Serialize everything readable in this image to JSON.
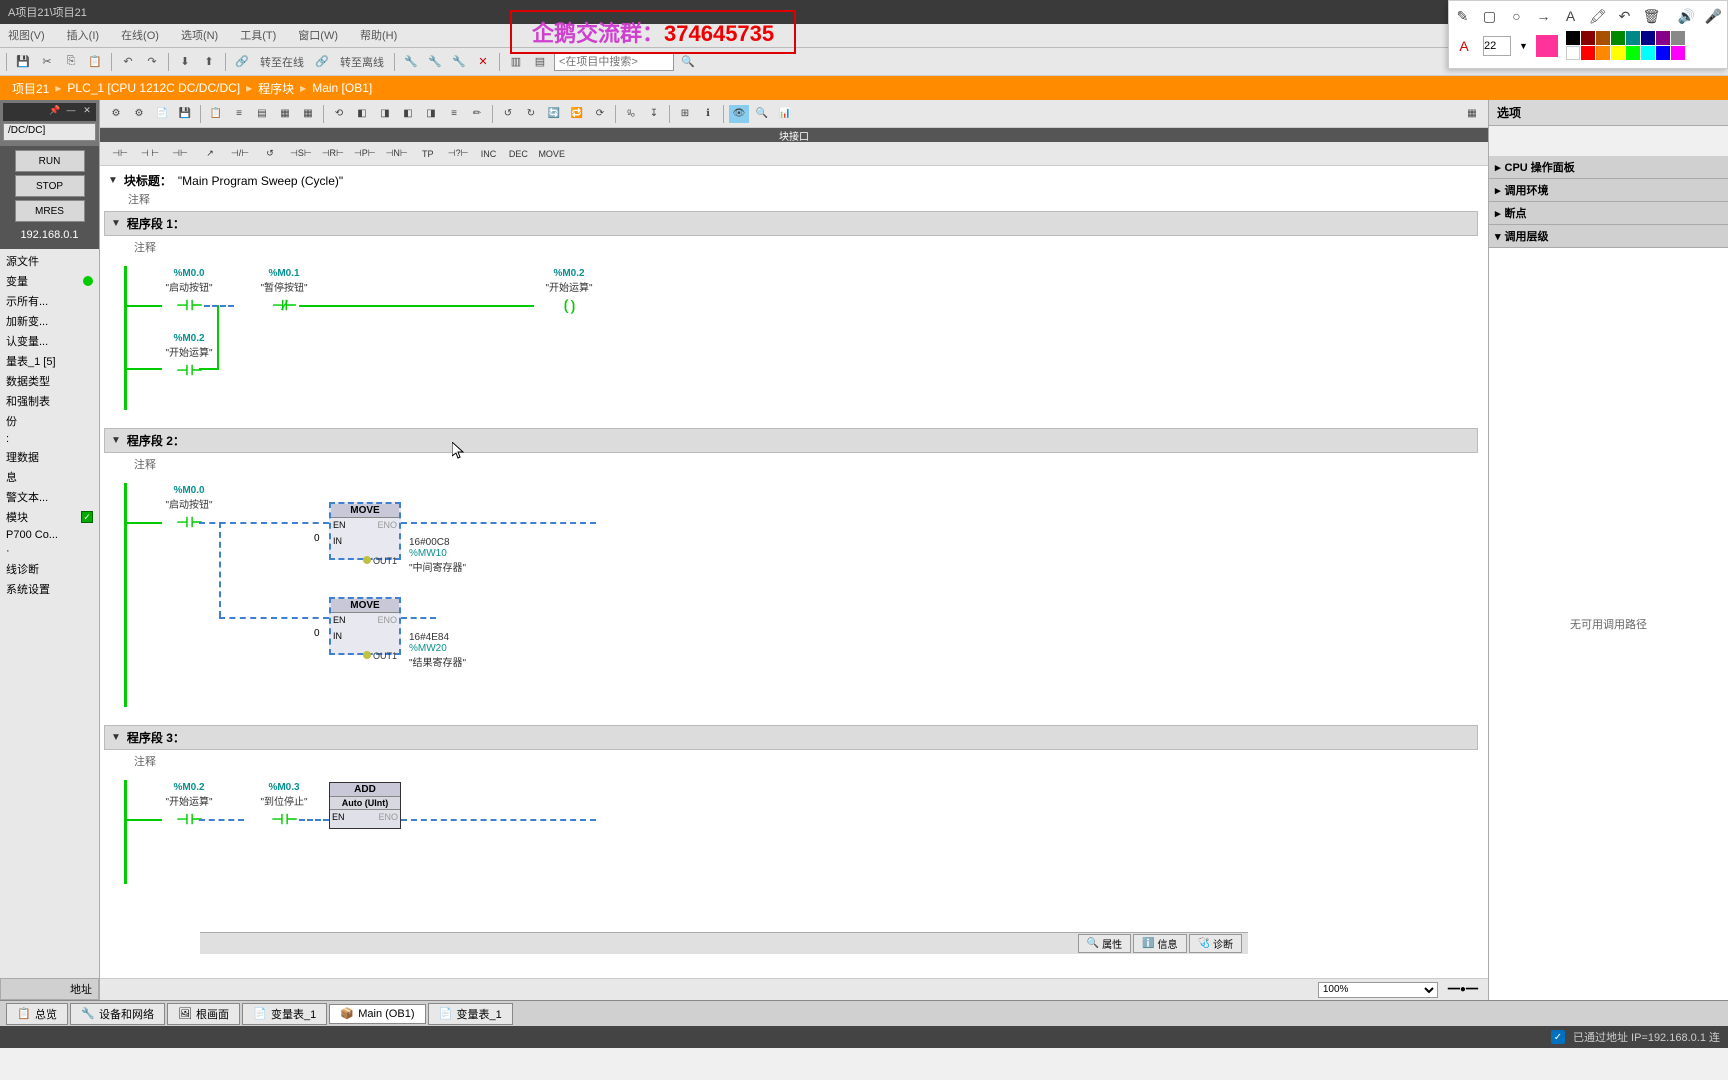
{
  "title_bar": "A项目21\\项目21",
  "overlay": {
    "label": "企鹅交流群：",
    "number": "374645735"
  },
  "menu": [
    "视图(V)",
    "插入(I)",
    "在线(O)",
    "选项(N)",
    "工具(T)",
    "窗口(W)",
    "帮助(H)"
  ],
  "toolbar": {
    "goto_online": "转至在线",
    "goto_offline": "转至离线",
    "search_placeholder": "<在项目中搜索>"
  },
  "breadcrumb": [
    "项目21",
    "PLC_1 [CPU 1212C DC/DC/DC]",
    "程序块",
    "Main [OB1]"
  ],
  "annotation": {
    "font_size": "22"
  },
  "cpu_panel": {
    "device": "/DC/DC]",
    "run": "RUN",
    "stop": "STOP",
    "mres": "MRES",
    "ip": "192.168.0.1"
  },
  "tree": [
    {
      "t": "源文件"
    },
    {
      "t": "变量",
      "dot": true
    },
    {
      "t": "示所有..."
    },
    {
      "t": "加新变..."
    },
    {
      "t": "认变量..."
    },
    {
      "t": "量表_1 [5]"
    },
    {
      "t": "数据类型"
    },
    {
      "t": "和强制表"
    },
    {
      "t": "份"
    },
    {
      "t": ":"
    },
    {
      "t": "理数据"
    },
    {
      "t": "息"
    },
    {
      "t": "警文本..."
    },
    {
      "t": "模块",
      "chk": true
    },
    {
      "t": "P700 Co..."
    },
    {
      "t": "·"
    },
    {
      "t": "线诊断"
    },
    {
      "t": "系统设置"
    }
  ],
  "addr_header": "地址",
  "block_interface_label": "块接口",
  "lad_toolbar": [
    "⊣⊢",
    "⊣ ⊢",
    "⊣⊢",
    "↗",
    "⊣/⊢",
    "↺",
    "⊣S⊢",
    "⊣R⊢",
    "⊣P⊢",
    "⊣N⊢",
    "TP",
    "⊣?⊢",
    "INC",
    "DEC",
    "MOVE"
  ],
  "block": {
    "header_label": "块标题：",
    "header_value": "\"Main Program Sweep (Cycle)\"",
    "comment": "注释"
  },
  "networks": [
    {
      "title": "程序段 1：",
      "comment": "注释",
      "contacts": [
        {
          "addr": "%M0.0",
          "sym": "\"启动按钮\"",
          "type": "no"
        },
        {
          "addr": "%M0.1",
          "sym": "\"暂停按钮\"",
          "type": "nc"
        },
        {
          "addr": "%M0.2",
          "sym": "\"开始运算\"",
          "type": "coil"
        },
        {
          "addr": "%M0.2",
          "sym": "\"开始运算\"",
          "type": "no",
          "branch": true
        }
      ]
    },
    {
      "title": "程序段 2：",
      "comment": "注释",
      "contacts": [
        {
          "addr": "%M0.0",
          "sym": "\"启动按钮\"",
          "type": "no"
        }
      ],
      "blocks": [
        {
          "name": "MOVE",
          "in": "0",
          "out_lit": "16#00C8",
          "out_addr": "%MW10",
          "out_sym": "\"中间寄存器\""
        },
        {
          "name": "MOVE",
          "in": "0",
          "out_lit": "16#4E84",
          "out_addr": "%MW20",
          "out_sym": "\"结果寄存器\""
        }
      ]
    },
    {
      "title": "程序段 3：",
      "comment": "注释",
      "contacts": [
        {
          "addr": "%M0.2",
          "sym": "\"开始运算\"",
          "type": "no"
        },
        {
          "addr": "%M0.3",
          "sym": "\"到位停止\"",
          "type": "no"
        }
      ],
      "blocks": [
        {
          "name": "ADD",
          "sub": "Auto (UInt)"
        }
      ]
    }
  ],
  "zoom": "100%",
  "right_panel": {
    "options": "选项",
    "sections": [
      "CPU 操作面板",
      "调用环境",
      "断点",
      "调用层级"
    ],
    "empty": "无可用调用路径"
  },
  "status_tabs": [
    {
      "icon": "🔍",
      "label": "属性"
    },
    {
      "icon": "ℹ️",
      "label": "信息"
    },
    {
      "icon": "🩺",
      "label": "诊断"
    }
  ],
  "bottom_tabs": [
    {
      "label": "总览",
      "icon": "📋"
    },
    {
      "label": "设备和网络",
      "icon": "🔧"
    },
    {
      "label": "根画面",
      "icon": "🖼"
    },
    {
      "label": "变量表_1",
      "icon": "📄"
    },
    {
      "label": "Main (OB1)",
      "icon": "📦",
      "active": true
    },
    {
      "label": "变量表_1",
      "icon": "📄"
    }
  ],
  "status_bar": "已通过地址 IP=192.168.0.1 连"
}
